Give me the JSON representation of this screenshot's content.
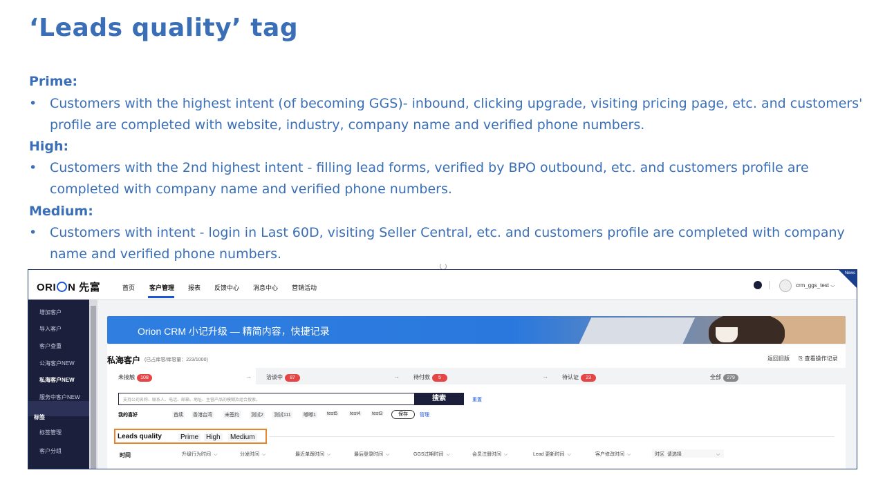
{
  "slide": {
    "title": "‘Leads quality’ tag",
    "sections": [
      {
        "heading": "Prime:",
        "lines": [
          "Customers with the highest intent (of becoming GGS)- inbound, clicking upgrade, visiting pricing page, etc. and customers'",
          "profile are completed with website, industry, company name and verified phone numbers."
        ]
      },
      {
        "heading": "High:",
        "lines": [
          "Customers with the 2nd highest intent - filling lead forms, verified by BPO outbound, etc. and customers profile are",
          "completed with company name and verified phone numbers."
        ]
      },
      {
        "heading": "Medium:",
        "lines": [
          "Customers with intent - login in Last 60D, visiting Seller Central, etc. and customers profile are completed with company",
          "name and verified phone numbers."
        ]
      }
    ],
    "bullet": "•"
  },
  "app": {
    "logo": {
      "part1": "ORI",
      "part2": "N 先富"
    },
    "nav": [
      "首页",
      "客户管理",
      "报表",
      "反馈中心",
      "消息中心",
      "营销活动"
    ],
    "user": "crm_ggs_test",
    "news": "News",
    "sidebar": {
      "items": [
        "增加客户",
        "导入客户",
        "客户查重",
        "公海客户NEW",
        "私海客户NEW",
        "服务中客户NEW",
        "标签",
        "标签管理",
        "客户分组"
      ]
    },
    "banner": "Orion CRM 小记升级 — 精简内容，快捷记录",
    "page": {
      "title": "私海客户",
      "subtitle": "(已占库容/库容量：223/1000)",
      "links": [
        "返回旧版",
        "查看操作记录"
      ]
    },
    "tabs": [
      {
        "label": "未接触",
        "count": "108"
      },
      {
        "label": "洽谈中",
        "count": "87"
      },
      {
        "label": "待付款",
        "count": "5"
      },
      {
        "label": "待认证",
        "count": "23"
      },
      {
        "label": "全部",
        "count": "279"
      }
    ],
    "search": {
      "placeholder": "支持公司名称、联系人、电话、邮箱、地址、主营产品的模糊及组合搜索。",
      "button": "搜索",
      "reset": "重置"
    },
    "preferences": {
      "label": "我的喜好",
      "chips": [
        "首续",
        "香港台湾",
        "未签约",
        "测试2",
        "测试111",
        "嘟嘟1",
        "test5",
        "test4",
        "test3"
      ],
      "save": "保存",
      "manage": "管理"
    },
    "leads_quality": {
      "label": "Leads quality",
      "options": [
        "Prime",
        "High",
        "Medium"
      ]
    },
    "time_filter": {
      "label": "时间",
      "fields": [
        "升级行为时间",
        "分发时间",
        "最近单跟时间",
        "最后登录时间",
        "GGS过期时间",
        "会员注册时间",
        "Lead 更新时间",
        "客户修改时间"
      ],
      "region_label": "时区",
      "region_value": "请选择"
    }
  }
}
